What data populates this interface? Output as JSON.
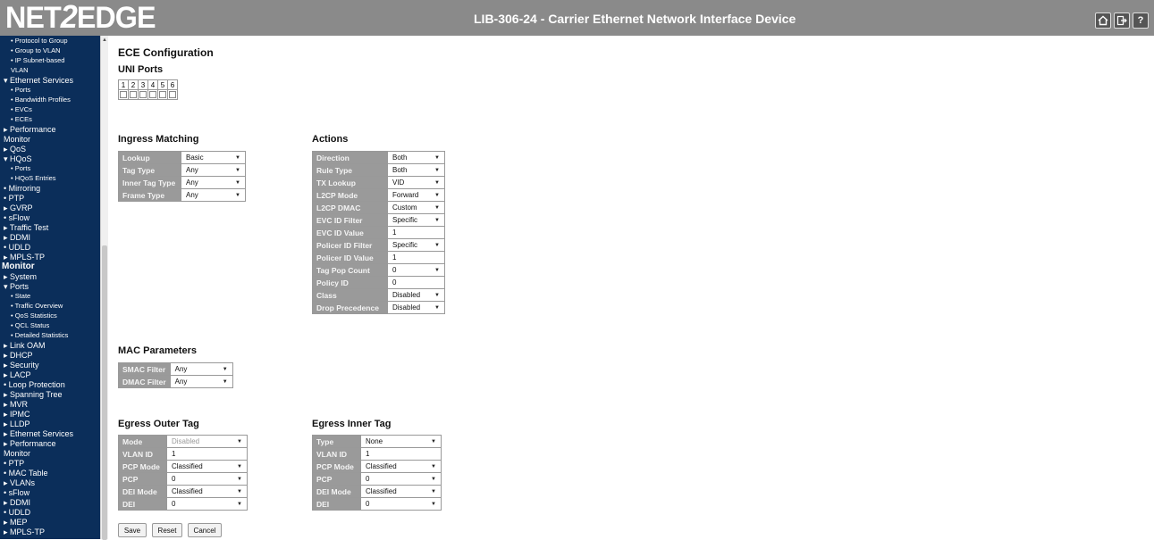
{
  "header": {
    "logo_left": "NET",
    "logo_two": "2",
    "logo_right": "EDGE",
    "device_title": "LIB-306-24 - Carrier Ethernet Network Interface Device",
    "home_icon": "home-icon",
    "logout_icon": "logout-icon",
    "help_label": "?"
  },
  "sidebar": {
    "items": [
      {
        "label": "• Protocol to Group",
        "kind": "sub"
      },
      {
        "label": "• Group to VLAN",
        "kind": "sub"
      },
      {
        "label": "• IP Subnet-based",
        "kind": "sub"
      },
      {
        "label": "VLAN",
        "kind": "sub"
      },
      {
        "label": "▾ Ethernet Services",
        "kind": "item"
      },
      {
        "label": "• Ports",
        "kind": "sub"
      },
      {
        "label": "• Bandwidth Profiles",
        "kind": "sub"
      },
      {
        "label": "• EVCs",
        "kind": "sub"
      },
      {
        "label": "• ECEs",
        "kind": "sub"
      },
      {
        "label": "▸ Performance",
        "kind": "item"
      },
      {
        "label": "Monitor",
        "kind": "item"
      },
      {
        "label": "▸ QoS",
        "kind": "item"
      },
      {
        "label": "▾ HQoS",
        "kind": "item"
      },
      {
        "label": "• Ports",
        "kind": "sub"
      },
      {
        "label": "• HQoS Entries",
        "kind": "sub"
      },
      {
        "label": "• Mirroring",
        "kind": "item"
      },
      {
        "label": "• PTP",
        "kind": "item"
      },
      {
        "label": "▸ GVRP",
        "kind": "item"
      },
      {
        "label": "• sFlow",
        "kind": "item"
      },
      {
        "label": "▸ Traffic Test",
        "kind": "item"
      },
      {
        "label": "▸ DDMI",
        "kind": "item"
      },
      {
        "label": "• UDLD",
        "kind": "item"
      },
      {
        "label": "▸ MPLS-TP",
        "kind": "item"
      },
      {
        "label": "Monitor",
        "kind": "head"
      },
      {
        "label": "▸ System",
        "kind": "item"
      },
      {
        "label": "▾ Ports",
        "kind": "item"
      },
      {
        "label": "• State",
        "kind": "sub"
      },
      {
        "label": "• Traffic Overview",
        "kind": "sub"
      },
      {
        "label": "• QoS Statistics",
        "kind": "sub"
      },
      {
        "label": "• QCL Status",
        "kind": "sub"
      },
      {
        "label": "• Detailed Statistics",
        "kind": "sub"
      },
      {
        "label": "▸ Link OAM",
        "kind": "item"
      },
      {
        "label": "▸ DHCP",
        "kind": "item"
      },
      {
        "label": "▸ Security",
        "kind": "item"
      },
      {
        "label": "▸ LACP",
        "kind": "item"
      },
      {
        "label": "• Loop Protection",
        "kind": "item"
      },
      {
        "label": "▸ Spanning Tree",
        "kind": "item"
      },
      {
        "label": "▸ MVR",
        "kind": "item"
      },
      {
        "label": "▸ IPMC",
        "kind": "item"
      },
      {
        "label": "▸ LLDP",
        "kind": "item"
      },
      {
        "label": "▸ Ethernet Services",
        "kind": "item"
      },
      {
        "label": "▸ Performance",
        "kind": "item"
      },
      {
        "label": "Monitor",
        "kind": "item"
      },
      {
        "label": "• PTP",
        "kind": "item"
      },
      {
        "label": "• MAC Table",
        "kind": "item"
      },
      {
        "label": "▸ VLANs",
        "kind": "item"
      },
      {
        "label": "• sFlow",
        "kind": "item"
      },
      {
        "label": "▸ DDMI",
        "kind": "item"
      },
      {
        "label": "• UDLD",
        "kind": "item"
      },
      {
        "label": "▸ MEP",
        "kind": "item"
      },
      {
        "label": "▸ MPLS-TP",
        "kind": "item"
      }
    ]
  },
  "page": {
    "title": "ECE Configuration",
    "uni_ports": {
      "title": "UNI Ports",
      "ports": [
        "1",
        "2",
        "3",
        "4",
        "5",
        "6"
      ],
      "checked": [
        false,
        false,
        false,
        false,
        false,
        false
      ]
    },
    "ingress": {
      "title": "Ingress Matching",
      "rows": [
        {
          "label": "Lookup",
          "value": "Basic",
          "type": "select"
        },
        {
          "label": "Tag Type",
          "value": "Any",
          "type": "select"
        },
        {
          "label": "Inner Tag Type",
          "value": "Any",
          "type": "select"
        },
        {
          "label": "Frame Type",
          "value": "Any",
          "type": "select"
        }
      ]
    },
    "actions": {
      "title": "Actions",
      "rows": [
        {
          "label": "Direction",
          "value": "Both",
          "type": "select"
        },
        {
          "label": "Rule Type",
          "value": "Both",
          "type": "select"
        },
        {
          "label": "TX Lookup",
          "value": "VID",
          "type": "select"
        },
        {
          "label": "L2CP Mode",
          "value": "Forward",
          "type": "select"
        },
        {
          "label": "L2CP DMAC",
          "value": "Custom",
          "type": "select"
        },
        {
          "label": "EVC ID Filter",
          "value": "Specific",
          "type": "select"
        },
        {
          "label": "EVC ID Value",
          "value": "1",
          "type": "text"
        },
        {
          "label": "Policer ID Filter",
          "value": "Specific",
          "type": "select"
        },
        {
          "label": "Policer ID Value",
          "value": "1",
          "type": "text"
        },
        {
          "label": "Tag Pop Count",
          "value": "0",
          "type": "select"
        },
        {
          "label": "Policy ID",
          "value": "0",
          "type": "text"
        },
        {
          "label": "Class",
          "value": "Disabled",
          "type": "select"
        },
        {
          "label": "Drop Precedence",
          "value": "Disabled",
          "type": "select"
        }
      ]
    },
    "mac": {
      "title": "MAC Parameters",
      "rows": [
        {
          "label": "SMAC Filter",
          "value": "Any",
          "type": "select"
        },
        {
          "label": "DMAC Filter",
          "value": "Any",
          "type": "select"
        }
      ]
    },
    "egress_outer": {
      "title": "Egress Outer Tag",
      "rows": [
        {
          "label": "Mode",
          "value": "Disabled",
          "type": "select-disabled"
        },
        {
          "label": "VLAN ID",
          "value": "1",
          "type": "text"
        },
        {
          "label": "PCP Mode",
          "value": "Classified",
          "type": "select"
        },
        {
          "label": "PCP",
          "value": "0",
          "type": "select"
        },
        {
          "label": "DEI Mode",
          "value": "Classified",
          "type": "select"
        },
        {
          "label": "DEI",
          "value": "0",
          "type": "select"
        }
      ]
    },
    "egress_inner": {
      "title": "Egress Inner Tag",
      "rows": [
        {
          "label": "Type",
          "value": "None",
          "type": "select"
        },
        {
          "label": "VLAN ID",
          "value": "1",
          "type": "text"
        },
        {
          "label": "PCP Mode",
          "value": "Classified",
          "type": "select"
        },
        {
          "label": "PCP",
          "value": "0",
          "type": "select"
        },
        {
          "label": "DEI Mode",
          "value": "Classified",
          "type": "select"
        },
        {
          "label": "DEI",
          "value": "0",
          "type": "select"
        }
      ]
    },
    "buttons": {
      "save": "Save",
      "reset": "Reset",
      "cancel": "Cancel"
    }
  }
}
